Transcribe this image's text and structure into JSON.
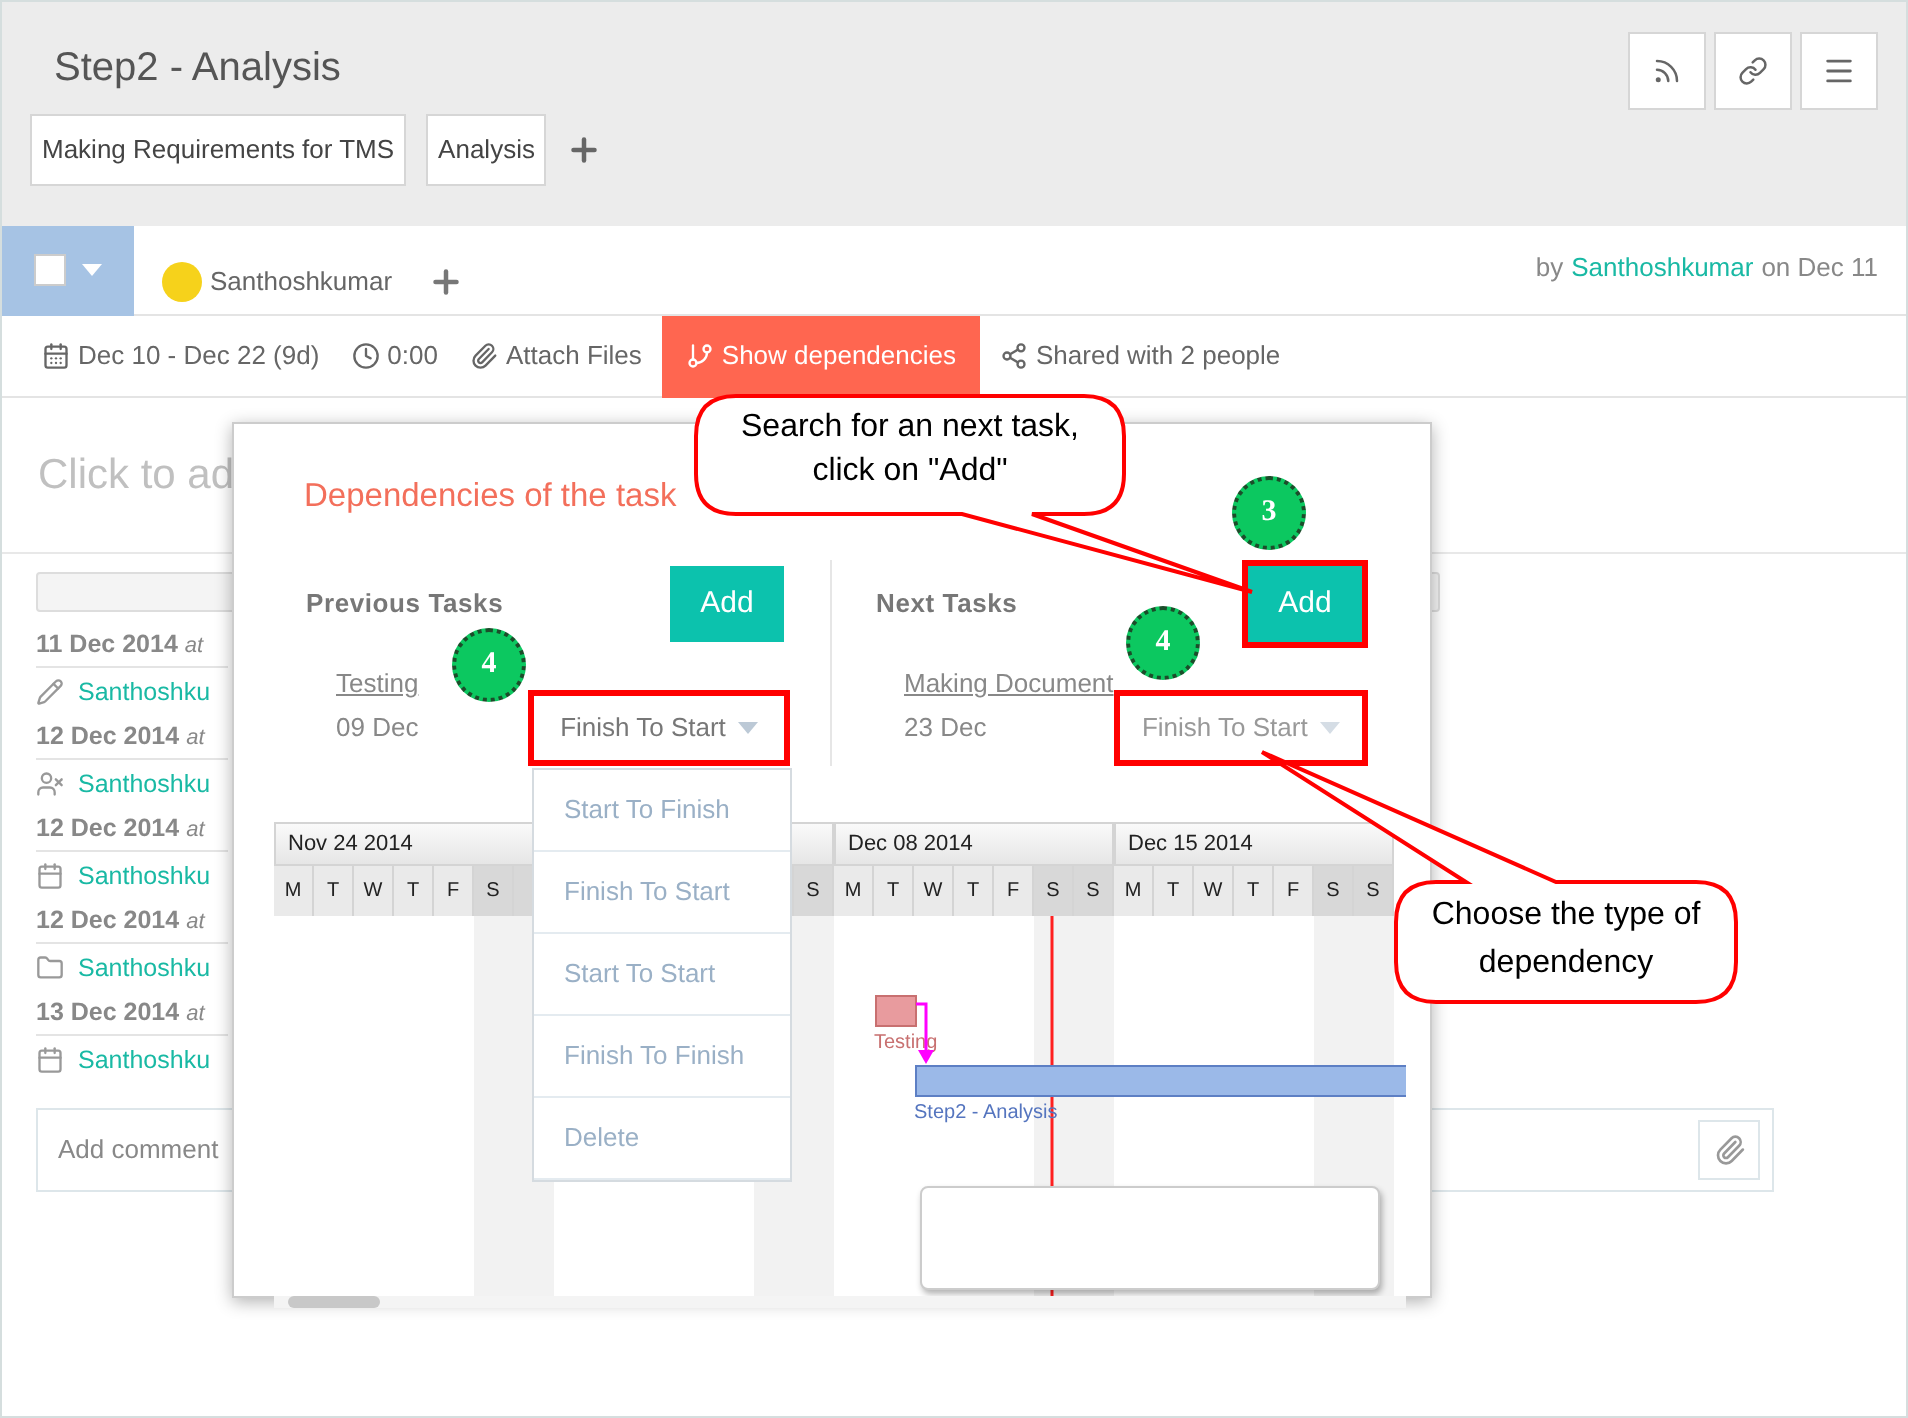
{
  "header": {
    "title": "Step2 - Analysis",
    "tags": [
      "Making Requirements for TMS",
      "Analysis"
    ]
  },
  "task_bar": {
    "checkbox": {
      "checked": false
    },
    "assignee": "Santhoshkumar",
    "created_prefix": "by",
    "created_author": "Santhoshkumar",
    "created_suffix": "on Dec 11"
  },
  "toolbar": [
    {
      "kind": "dates",
      "label": "Dec 10 - Dec 22 (9d)",
      "selected": false
    },
    {
      "kind": "time",
      "label": "0:00",
      "selected": false
    },
    {
      "kind": "attach",
      "label": "Attach Files",
      "selected": false
    },
    {
      "kind": "dependencies",
      "label": "Show dependencies",
      "selected": true
    },
    {
      "kind": "share",
      "label": "Shared with 2 people",
      "selected": false
    }
  ],
  "description_placeholder": "Click to ad",
  "activity": [
    {
      "date": "11 Dec 2014",
      "at": "at",
      "kind": "edit",
      "user": "Santhoshku"
    },
    {
      "date": "12 Dec 2014",
      "at": "at",
      "kind": "assign",
      "user": "Santhoshku"
    },
    {
      "date": "12 Dec 2014",
      "at": "at",
      "kind": "calendar",
      "user": "Santhoshku"
    },
    {
      "date": "12 Dec 2014",
      "at": "at",
      "kind": "folder",
      "user": "Santhoshku"
    },
    {
      "date": "13 Dec 2014",
      "at": "at",
      "kind": "calendar",
      "user": "Santhoshku"
    }
  ],
  "comment": {
    "placeholder": "Add comment"
  },
  "modal": {
    "title": "Dependencies of the task",
    "columns": [
      {
        "heading": "Previous Tasks",
        "add": "Add",
        "task": "Testing",
        "date": "09 Dec",
        "type": "Finish To Start",
        "expanded": true
      },
      {
        "heading": "Next Tasks",
        "add": "Add",
        "task": "Making Document",
        "date": "23 Dec",
        "type": "Finish To Start",
        "expanded": false
      }
    ],
    "menu": [
      "Start To Finish",
      "Finish To Start",
      "Start To Start",
      "Finish To Finish",
      "Delete"
    ],
    "gantt": {
      "weeks": [
        {
          "label": "Nov 24 2014",
          "days": [
            "M",
            "T",
            "W",
            "T",
            "F",
            "S"
          ]
        },
        {
          "days": [
            "S"
          ]
        },
        {
          "label": "Dec 08 2014",
          "days": [
            "M",
            "T",
            "W",
            "T",
            "F",
            "S",
            "S"
          ]
        },
        {
          "label": "Dec 15 2014",
          "days": [
            "M",
            "T",
            "W",
            "T",
            "F",
            "S",
            "S"
          ]
        }
      ],
      "tasks": [
        {
          "name": "Testing",
          "kind": "previous"
        },
        {
          "name": "Step2 - Analysis",
          "kind": "current"
        }
      ]
    }
  },
  "callouts": [
    "Search for an next task, click on \"Add\"",
    "Choose the type of dependency"
  ],
  "steps": [
    "3",
    "4",
    "4"
  ]
}
